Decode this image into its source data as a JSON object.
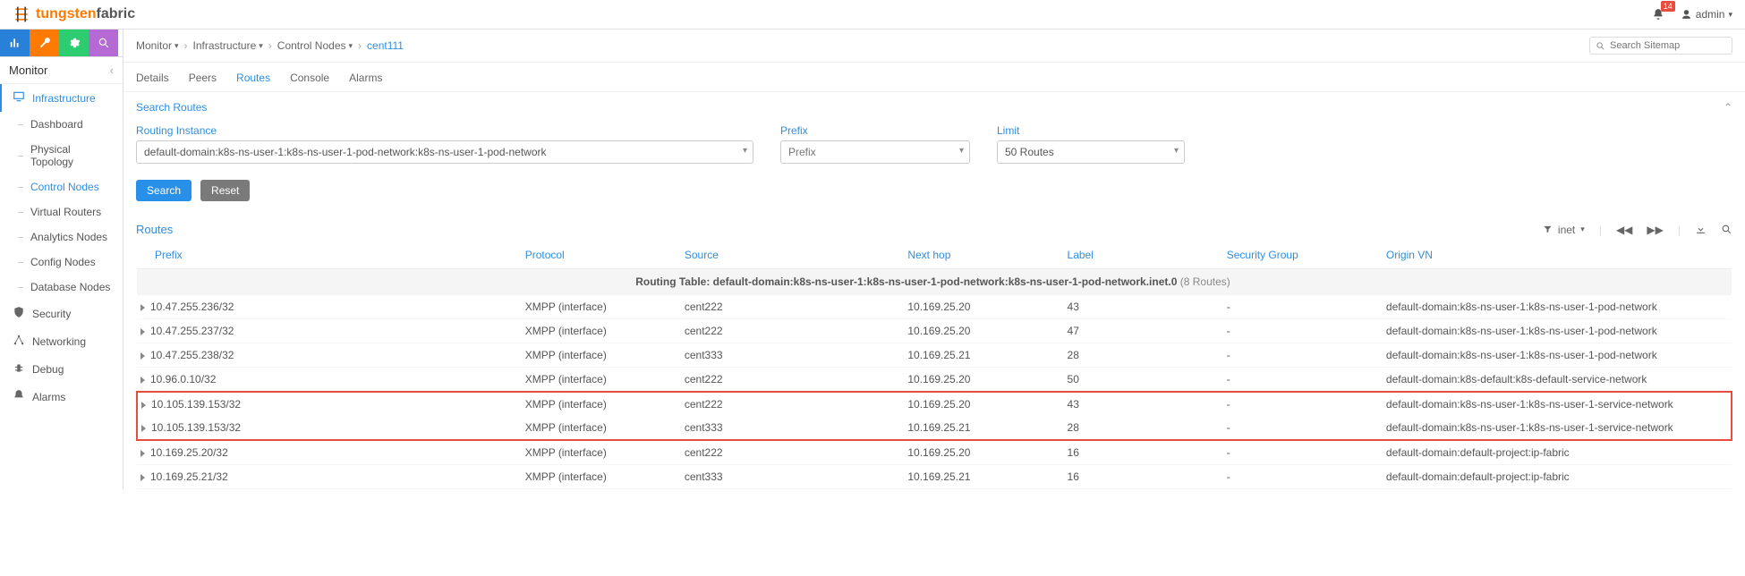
{
  "brand": {
    "word1": "tungsten",
    "word2": "fabric"
  },
  "header": {
    "notif_count": "14",
    "user_label": "admin"
  },
  "icon_strip": [
    "chart",
    "config",
    "settings",
    "search"
  ],
  "sidebar": {
    "title": "Monitor",
    "items": [
      {
        "label": "Infrastructure",
        "level": 1,
        "active": true,
        "icon": "monitor"
      },
      {
        "label": "Dashboard",
        "level": 2
      },
      {
        "label": "Physical Topology",
        "level": 2
      },
      {
        "label": "Control Nodes",
        "level": 2,
        "active": true
      },
      {
        "label": "Virtual Routers",
        "level": 2
      },
      {
        "label": "Analytics Nodes",
        "level": 2
      },
      {
        "label": "Config Nodes",
        "level": 2
      },
      {
        "label": "Database Nodes",
        "level": 2
      },
      {
        "label": "Security",
        "level": 1,
        "icon": "shield"
      },
      {
        "label": "Networking",
        "level": 1,
        "icon": "network"
      },
      {
        "label": "Debug",
        "level": 1,
        "icon": "bug"
      },
      {
        "label": "Alarms",
        "level": 1,
        "icon": "bell"
      }
    ]
  },
  "breadcrumbs": [
    {
      "label": "Monitor",
      "dd": true
    },
    {
      "label": "Infrastructure",
      "dd": true
    },
    {
      "label": "Control Nodes",
      "dd": true
    },
    {
      "label": "cent111",
      "active": true
    }
  ],
  "sitemap_placeholder": "Search Sitemap",
  "tabs": [
    {
      "label": "Details"
    },
    {
      "label": "Peers"
    },
    {
      "label": "Routes",
      "active": true
    },
    {
      "label": "Console"
    },
    {
      "label": "Alarms"
    }
  ],
  "search_panel": {
    "title": "Search Routes",
    "routing_label": "Routing Instance",
    "routing_value": "default-domain:k8s-ns-user-1:k8s-ns-user-1-pod-network:k8s-ns-user-1-pod-network",
    "prefix_label": "Prefix",
    "prefix_placeholder": "Prefix",
    "limit_label": "Limit",
    "limit_value": "50 Routes",
    "search_btn": "Search",
    "reset_btn": "Reset"
  },
  "routes": {
    "title": "Routes",
    "filter_label": "inet",
    "columns": [
      "Prefix",
      "Protocol",
      "Source",
      "Next hop",
      "Label",
      "Security Group",
      "Origin VN"
    ],
    "group_header_prefix": "Routing Table: ",
    "group_header_value": "default-domain:k8s-ns-user-1:k8s-ns-user-1-pod-network:k8s-ns-user-1-pod-network.inet.0",
    "group_header_count": " (8 Routes)",
    "rows": [
      {
        "prefix": "10.47.255.236/32",
        "proto": "XMPP (interface)",
        "src": "cent222",
        "nh": "10.169.25.20",
        "label": "43",
        "sg": "-",
        "ovn": "default-domain:k8s-ns-user-1:k8s-ns-user-1-pod-network"
      },
      {
        "prefix": "10.47.255.237/32",
        "proto": "XMPP (interface)",
        "src": "cent222",
        "nh": "10.169.25.20",
        "label": "47",
        "sg": "-",
        "ovn": "default-domain:k8s-ns-user-1:k8s-ns-user-1-pod-network"
      },
      {
        "prefix": "10.47.255.238/32",
        "proto": "XMPP (interface)",
        "src": "cent333",
        "nh": "10.169.25.21",
        "label": "28",
        "sg": "-",
        "ovn": "default-domain:k8s-ns-user-1:k8s-ns-user-1-pod-network"
      },
      {
        "prefix": "10.96.0.10/32",
        "proto": "XMPP (interface)",
        "src": "cent222",
        "nh": "10.169.25.20",
        "label": "50",
        "sg": "-",
        "ovn": "default-domain:k8s-default:k8s-default-service-network"
      },
      {
        "prefix": "10.105.139.153/32",
        "proto": "XMPP (interface)",
        "src": "cent222",
        "nh": "10.169.25.20",
        "label": "43",
        "sg": "-",
        "ovn": "default-domain:k8s-ns-user-1:k8s-ns-user-1-service-network",
        "highlight": true
      },
      {
        "prefix": "10.105.139.153/32",
        "proto": "XMPP (interface)",
        "src": "cent333",
        "nh": "10.169.25.21",
        "label": "28",
        "sg": "-",
        "ovn": "default-domain:k8s-ns-user-1:k8s-ns-user-1-service-network",
        "highlight": true
      },
      {
        "prefix": "10.169.25.20/32",
        "proto": "XMPP (interface)",
        "src": "cent222",
        "nh": "10.169.25.20",
        "label": "16",
        "sg": "-",
        "ovn": "default-domain:default-project:ip-fabric"
      },
      {
        "prefix": "10.169.25.21/32",
        "proto": "XMPP (interface)",
        "src": "cent333",
        "nh": "10.169.25.21",
        "label": "16",
        "sg": "-",
        "ovn": "default-domain:default-project:ip-fabric"
      }
    ]
  }
}
